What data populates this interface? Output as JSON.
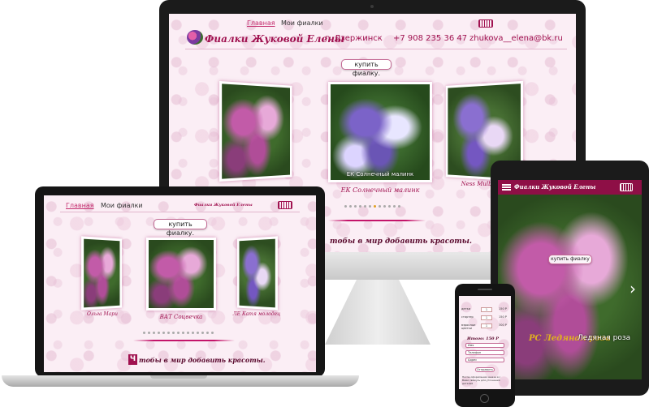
{
  "desktop": {
    "nav": {
      "home": "Главная",
      "my_violets": "Мои фиалки"
    },
    "brand": "Фиалки Жуковой Елены",
    "city": "г. Дзержинск",
    "phone": "+7 908 235 36 47",
    "email": "zhukova__elena@bk.ru",
    "buy_button": "купить фиалку.",
    "slides": [
      {
        "caption": ""
      },
      {
        "overlay": "ЕК Солнечный малинк",
        "caption": "ЕК Солнечный малинк"
      },
      {
        "caption": "Ness Mulberry"
      }
    ],
    "tagline": "тобы в мир добавить красоты."
  },
  "laptop": {
    "nav": {
      "home": "Главная",
      "my_violets": "Мои фиалки"
    },
    "brand": "Фиалки Жуковой Елены",
    "buy_button": "купить фиалку.",
    "slides": [
      {
        "caption": "Ольга Мари"
      },
      {
        "caption": "ВАТ Соцвечка"
      },
      {
        "caption": "ЛЕ Катя молодец"
      }
    ],
    "tagline_initial": "Ч",
    "tagline": "тобы в мир добавить красоты."
  },
  "tablet": {
    "brand": "Фиалки Жуковой Елены",
    "buy_button": "купить фиалку",
    "prev": "‹",
    "next": "›",
    "caption": "РС Ледяная роза",
    "caption_overlay": "Ледяная роза"
  },
  "phone": {
    "rows": [
      {
        "label": "детки",
        "qty": "1",
        "price": "150 Р"
      },
      {
        "label": "стартер",
        "qty": "1",
        "price": "150 Р"
      },
      {
        "label": "взрослые цветки",
        "qty": "1",
        "price": "300 Р"
      }
    ],
    "total": "Итого: 150 Р",
    "field1": "Имя",
    "field2": "Телефон",
    "field3": "Адрес",
    "submit": "Отправить",
    "note": "После оформления заказа я с Вами свяжусь для уточнения деталей"
  }
}
